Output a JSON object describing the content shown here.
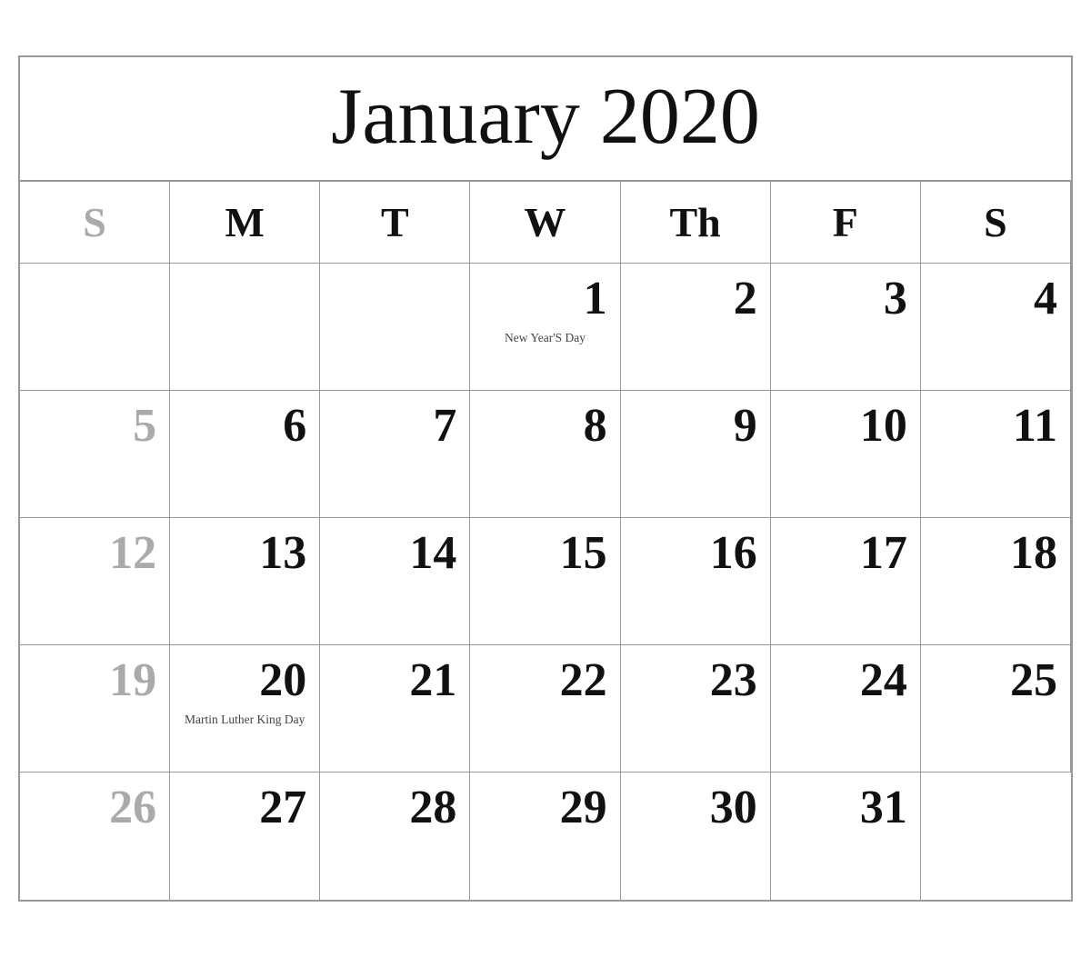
{
  "calendar": {
    "title": "January 2020",
    "headers": [
      {
        "label": "S",
        "id": "sunday",
        "is_sunday": true
      },
      {
        "label": "M",
        "id": "monday",
        "is_sunday": false
      },
      {
        "label": "T",
        "id": "tuesday",
        "is_sunday": false
      },
      {
        "label": "W",
        "id": "wednesday",
        "is_sunday": false
      },
      {
        "label": "Th",
        "id": "thursday",
        "is_sunday": false
      },
      {
        "label": "F",
        "id": "friday",
        "is_sunday": false
      },
      {
        "label": "S",
        "id": "saturday",
        "is_sunday": false
      }
    ],
    "weeks": [
      {
        "days": [
          {
            "number": "",
            "empty": true,
            "holiday": ""
          },
          {
            "number": "",
            "empty": true,
            "holiday": ""
          },
          {
            "number": "",
            "empty": true,
            "holiday": ""
          },
          {
            "number": "1",
            "empty": false,
            "holiday": "New Year'S Day",
            "sunday": false
          },
          {
            "number": "2",
            "empty": false,
            "holiday": "",
            "sunday": false
          },
          {
            "number": "3",
            "empty": false,
            "holiday": "",
            "sunday": false
          },
          {
            "number": "4",
            "empty": false,
            "holiday": "",
            "sunday": false
          }
        ]
      },
      {
        "days": [
          {
            "number": "5",
            "empty": false,
            "holiday": "",
            "sunday": true
          },
          {
            "number": "6",
            "empty": false,
            "holiday": "",
            "sunday": false
          },
          {
            "number": "7",
            "empty": false,
            "holiday": "",
            "sunday": false
          },
          {
            "number": "8",
            "empty": false,
            "holiday": "",
            "sunday": false
          },
          {
            "number": "9",
            "empty": false,
            "holiday": "",
            "sunday": false
          },
          {
            "number": "10",
            "empty": false,
            "holiday": "",
            "sunday": false
          },
          {
            "number": "11",
            "empty": false,
            "holiday": "",
            "sunday": false
          }
        ]
      },
      {
        "days": [
          {
            "number": "12",
            "empty": false,
            "holiday": "",
            "sunday": true
          },
          {
            "number": "13",
            "empty": false,
            "holiday": "",
            "sunday": false
          },
          {
            "number": "14",
            "empty": false,
            "holiday": "",
            "sunday": false
          },
          {
            "number": "15",
            "empty": false,
            "holiday": "",
            "sunday": false
          },
          {
            "number": "16",
            "empty": false,
            "holiday": "",
            "sunday": false
          },
          {
            "number": "17",
            "empty": false,
            "holiday": "",
            "sunday": false
          },
          {
            "number": "18",
            "empty": false,
            "holiday": "",
            "sunday": false
          }
        ]
      },
      {
        "days": [
          {
            "number": "19",
            "empty": false,
            "holiday": "",
            "sunday": true
          },
          {
            "number": "20",
            "empty": false,
            "holiday": "Martin Luther King Day",
            "sunday": false
          },
          {
            "number": "21",
            "empty": false,
            "holiday": "",
            "sunday": false
          },
          {
            "number": "22",
            "empty": false,
            "holiday": "",
            "sunday": false
          },
          {
            "number": "23",
            "empty": false,
            "holiday": "",
            "sunday": false
          },
          {
            "number": "24",
            "empty": false,
            "holiday": "",
            "sunday": false
          },
          {
            "number": "25",
            "empty": false,
            "holiday": "",
            "sunday": false
          }
        ]
      },
      {
        "days": [
          {
            "number": "26",
            "empty": false,
            "holiday": "",
            "sunday": true
          },
          {
            "number": "27",
            "empty": false,
            "holiday": "",
            "sunday": false
          },
          {
            "number": "28",
            "empty": false,
            "holiday": "",
            "sunday": false
          },
          {
            "number": "29",
            "empty": false,
            "holiday": "",
            "sunday": false
          },
          {
            "number": "30",
            "empty": false,
            "holiday": "",
            "sunday": false
          },
          {
            "number": "31",
            "empty": false,
            "holiday": "",
            "sunday": false
          },
          {
            "number": "",
            "empty": true,
            "holiday": "",
            "sunday": false
          }
        ]
      }
    ]
  }
}
